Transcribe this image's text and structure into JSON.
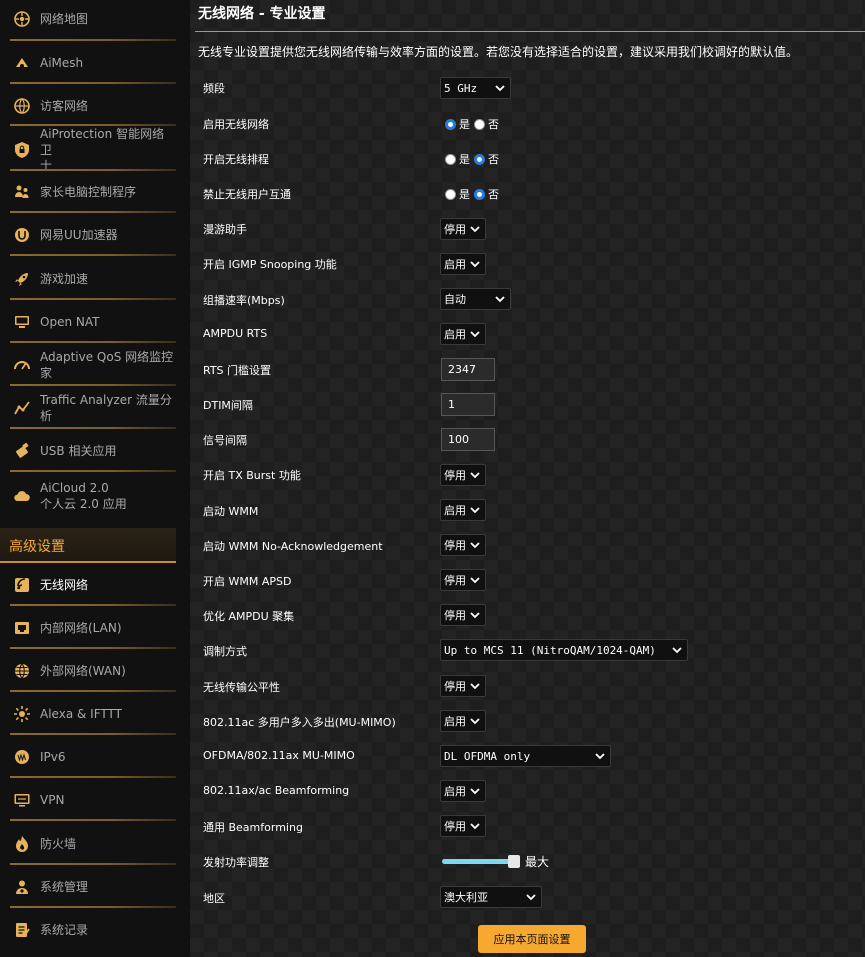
{
  "sidebar": {
    "items": [
      {
        "label": "网络地图",
        "icon": "network-map-icon"
      },
      {
        "label": "AiMesh",
        "icon": "aimesh-icon"
      },
      {
        "label": "访客网络",
        "icon": "guest-network-icon"
      },
      {
        "label": "AiProtection 智能网络卫",
        "label2": "士",
        "icon": "shield-icon"
      },
      {
        "label": "家长电脑控制程序",
        "icon": "parental-control-icon"
      },
      {
        "label": "网易UU加速器",
        "icon": "uu-accelerator-icon"
      },
      {
        "label": "游戏加速",
        "icon": "rocket-icon"
      },
      {
        "label": "Open NAT",
        "icon": "open-nat-icon"
      },
      {
        "label": "Adaptive QoS 网络监控家",
        "icon": "gauge-icon"
      },
      {
        "label": "Traffic Analyzer 流量分析",
        "icon": "traffic-analyzer-icon"
      },
      {
        "label": "USB 相关应用",
        "icon": "usb-icon"
      },
      {
        "label": "AiCloud 2.0",
        "label2": "个人云 2.0 应用",
        "icon": "cloud-icon"
      }
    ],
    "advanced_header": "高级设置",
    "advanced_items": [
      {
        "label": "无线网络",
        "icon": "wireless-icon"
      },
      {
        "label": "内部网络(LAN)",
        "icon": "lan-icon"
      },
      {
        "label": "外部网络(WAN)",
        "icon": "globe-icon"
      },
      {
        "label": "Alexa & IFTTT",
        "icon": "alexa-icon"
      },
      {
        "label": "IPv6",
        "icon": "ipv6-icon"
      },
      {
        "label": "VPN",
        "icon": "vpn-icon"
      },
      {
        "label": "防火墙",
        "icon": "firewall-icon"
      },
      {
        "label": "系统管理",
        "icon": "admin-gear-icon"
      },
      {
        "label": "系统记录",
        "icon": "log-icon"
      }
    ]
  },
  "main": {
    "title": "无线网络 - 专业设置",
    "description": "无线专业设置提供您无线网络传输与效率方面的设置。若您没有选择适合的设置，建议采用我们校调好的默认值。",
    "yes": "是",
    "no": "否",
    "rows": {
      "band": {
        "label": "频段",
        "value": "5 GHz"
      },
      "enable_radio": {
        "label": "启用无线网络",
        "selected": "yes"
      },
      "wireless_schedule": {
        "label": "开启无线排程",
        "selected": "no"
      },
      "ap_isolation": {
        "label": "禁止无线用户互通",
        "selected": "no"
      },
      "roaming_assistant": {
        "label": "漫游助手",
        "value": "停用"
      },
      "igmp_snooping": {
        "label": "开启 IGMP Snooping 功能",
        "value": "启用"
      },
      "multicast_rate": {
        "label": "组播速率(Mbps)",
        "value": "自动"
      },
      "ampdu_rts": {
        "label": "AMPDU RTS",
        "value": "启用"
      },
      "rts_threshold": {
        "label": "RTS 门槛设置",
        "value": "2347"
      },
      "dtim": {
        "label": "DTIM间隔",
        "value": "1"
      },
      "beacon": {
        "label": "信号间隔",
        "value": "100"
      },
      "tx_burst": {
        "label": "开启 TX Burst 功能",
        "value": "停用"
      },
      "wmm": {
        "label": "启动 WMM",
        "value": "启用"
      },
      "wmm_noack": {
        "label": "启动 WMM No-Acknowledgement",
        "value": "停用"
      },
      "wmm_apsd": {
        "label": "开启 WMM APSD",
        "value": "停用"
      },
      "ampdu_agg": {
        "label": "优化 AMPDU 聚集",
        "value": "停用"
      },
      "modulation": {
        "label": "调制方式",
        "value": "Up to MCS 11 (NitroQAM/1024-QAM)"
      },
      "airtime_fairness": {
        "label": "无线传输公平性",
        "value": "停用"
      },
      "mu_mimo": {
        "label": "802.11ac 多用户多入多出(MU-MIMO)",
        "value": "启用"
      },
      "ofdma": {
        "label": "OFDMA/802.11ax MU-MIMO",
        "value": "DL OFDMA only"
      },
      "beamforming": {
        "label": "802.11ax/ac Beamforming",
        "value": "启用"
      },
      "universal_beamforming": {
        "label": "通用 Beamforming",
        "value": "停用"
      },
      "tx_power": {
        "label": "发射功率调整",
        "value_text": "最大",
        "level": 1.0
      },
      "region": {
        "label": "地区",
        "value": "澳大利亚"
      }
    },
    "apply_label": "应用本页面设置"
  }
}
